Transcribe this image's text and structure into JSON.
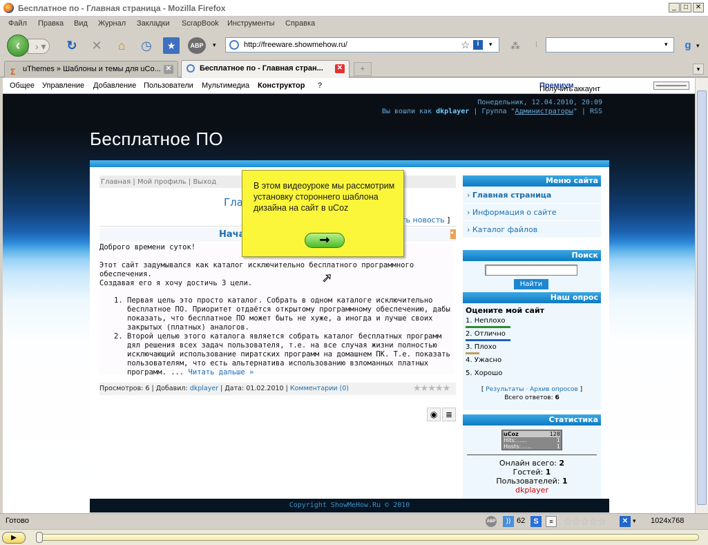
{
  "window": {
    "title": "Бесплатное по - Главная страница - Mozilla Firefox"
  },
  "menu": [
    "Файл",
    "Правка",
    "Вид",
    "Журнал",
    "Закладки",
    "ScrapBook",
    "Инструменты",
    "Справка"
  ],
  "nav": {
    "url": "http://freeware.showmehow.ru/",
    "abp_label": "ABP",
    "back_icon": "back-arrow-icon",
    "search_placeholder": ""
  },
  "tabs": [
    {
      "label": "uThemes » Шаблоны и темы для uCo...",
      "active": false
    },
    {
      "label": "Бесплатное по - Главная стран...",
      "active": true
    }
  ],
  "ucoz_panel": {
    "items": [
      "Общее",
      "Управление",
      "Добавление",
      "Пользователи",
      "Мультимедиа",
      "Конструктор",
      "?"
    ],
    "premium_prefix": "Получить",
    "premium_bold": "Премиум",
    "premium_suffix": "аккаунт"
  },
  "site": {
    "date_line": "Понедельник, 12.04.2010, 20:09",
    "login_prefix": "Вы вошли как",
    "user": "dkplayer",
    "group_prefix": "| Группа \"",
    "group": "Администраторы",
    "group_suffix": "\" |",
    "rss": "RSS",
    "title": "Бесплатное ПО",
    "breadcrumb": [
      "Главная",
      "Мой профиль",
      "Выход"
    ],
    "page_heading": "Гла",
    "add_news": "ить новость",
    "add_news_bracket": "]",
    "article_heading": "Нача",
    "greeting": "Доброго времени суток!",
    "para1": "Этот сайт задумывался как каталог исключительно бесплатного программного обеспечения.",
    "para2": "Создавая его я хочу достичь 3 цели.",
    "list": [
      "Первая цель это просто каталог. Собрать в одном каталоге исключительно бесплатное ПО. Приоритет отдаётся открытому программному обеспечению, дабы показать, что бесплатное ПО может быть не хуже, а иногда и лучше своих закрытых (платных) аналогов.",
      "Второй целью этого каталога является собрать каталог бесплатных программ дял решения всех задач пользователя, т.е. на все случая жизни полностью исключающий использование пиратских программ на домашнем ПК. Т.е. показать пользователям, что есть альтернатива использованию взломанных платных программ. ..."
    ],
    "read_more": "Читать дальше »",
    "meta": {
      "views_label": "Просмотров:",
      "views": "6",
      "added_label": "Добавил:",
      "author": "dkplayer",
      "date_label": "Дата:",
      "date": "01.02.2010",
      "comments": "Комментарии (0)"
    },
    "menu_title": "Меню сайта",
    "menu_items": [
      "Главная страница",
      "Информация о сайте",
      "Каталог файлов"
    ],
    "search_title": "Поиск",
    "search_button": "Найти",
    "poll_title": "Наш опрос",
    "poll_question": "Оцените мой сайт",
    "poll_options": [
      {
        "label": "1. Неплохо",
        "bar_color": "#2e8b2e",
        "share": 0.5
      },
      {
        "label": "2. Отлично",
        "bar_color": "#2060c0",
        "share": 0.5
      },
      {
        "label": "3. Плохо",
        "bar_color": "#c0a060",
        "share": 0.15
      },
      {
        "label": "4. Ужасно",
        "bar_color": "",
        "share": 0
      },
      {
        "label": "5. Хорошо",
        "bar_color": "",
        "share": 0
      }
    ],
    "poll_results": "Результаты",
    "poll_archive": "Архив опросов",
    "poll_total_label": "Всего ответов:",
    "poll_total": "6",
    "stats_title": "Статистика",
    "counter": {
      "brand": "uCoz",
      "count": "128",
      "hits_label": "Hits:......",
      "hits": "1",
      "hosts_label": "Hosts:......",
      "hosts": "1"
    },
    "online_label": "Онлайн всего:",
    "online": "2",
    "guests_label": "Гостей:",
    "guests": "1",
    "users_label": "Пользователей:",
    "users": "1",
    "online_user": "dkplayer",
    "footer": "Copyright ShowMeHow.Ru © 2010"
  },
  "popup": {
    "text": "В этом видеоуроке мы рассмотрим установку стороннего шаблона дизайна на сайт в uCoz",
    "button_icon": "right-arrow-icon"
  },
  "status": {
    "text": "Готово",
    "count": "62",
    "resolution": "1024x768"
  }
}
